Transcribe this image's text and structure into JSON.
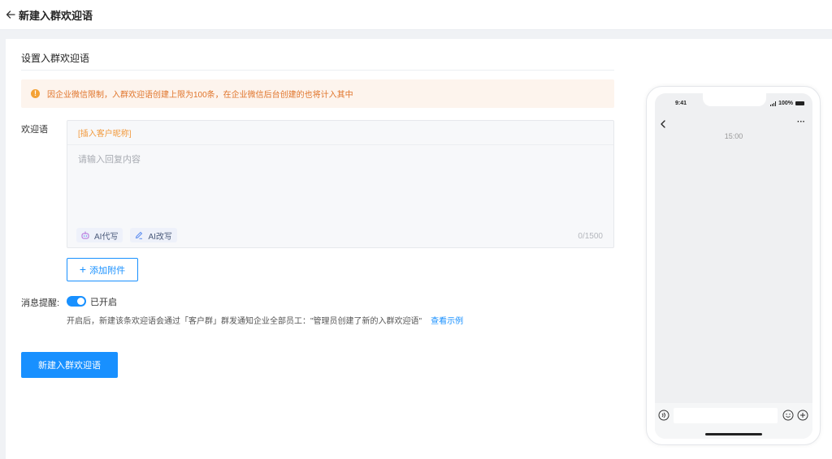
{
  "header": {
    "title": "新建入群欢迎语"
  },
  "form": {
    "section_title": "设置入群欢迎语",
    "alert": {
      "icon": "warning-icon",
      "text": "因企业微信限制，入群欢迎语创建上限为100条，在企业微信后台创建的也将计入其中"
    },
    "welcome": {
      "label": "欢迎语",
      "insert_nickname": "[插入客户昵称]",
      "placeholder": "请输入回复内容",
      "value": "",
      "ai_write": "AI代写",
      "ai_rewrite": "AI改写",
      "counter": "0/1500"
    },
    "attach_button": "添加附件",
    "notify": {
      "label": "消息提醒:",
      "enabled": true,
      "status": "已开启",
      "hint": "开启后，新建该条欢迎语会通过「客户群」群发通知企业全部员工：\"管理员创建了新的入群欢迎语\"",
      "example_link": "查看示例"
    },
    "submit_button": "新建入群欢迎语"
  },
  "preview": {
    "status_time": "9:41",
    "battery": "100%",
    "chat_time": "15:00"
  },
  "colors": {
    "primary": "#1890ff",
    "warning": "#f4a236",
    "alert_bg": "#fdf4ed",
    "nickname": "#f29a3d"
  }
}
